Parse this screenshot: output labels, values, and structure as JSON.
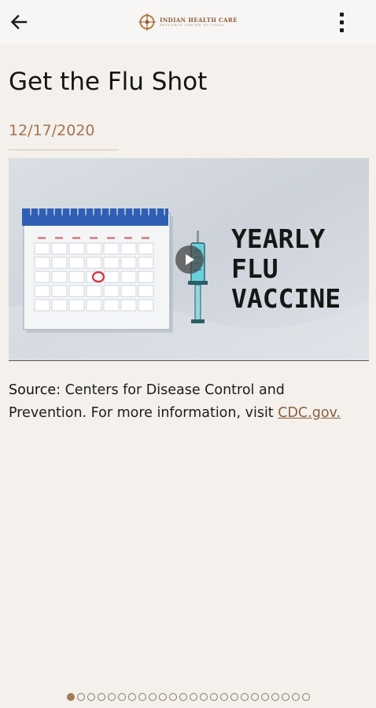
{
  "header": {
    "logo_name": "INDIAN HEALTH CARE",
    "logo_sub": "RESOURCE CENTER OF TULSA"
  },
  "article": {
    "title": "Get the Flu Shot",
    "date": "12/17/2020",
    "media": {
      "overlay_text": "YEARLY\nFLU\nVACCINE"
    },
    "source_label": "Source",
    "source_text": ": Centers for Disease Control and Prevention. For more information, visit ",
    "source_link": "CDC.gov."
  },
  "pager": {
    "total": 24,
    "current": 1
  },
  "colors": {
    "accent": "#a47451",
    "background": "#f4f0eb"
  }
}
